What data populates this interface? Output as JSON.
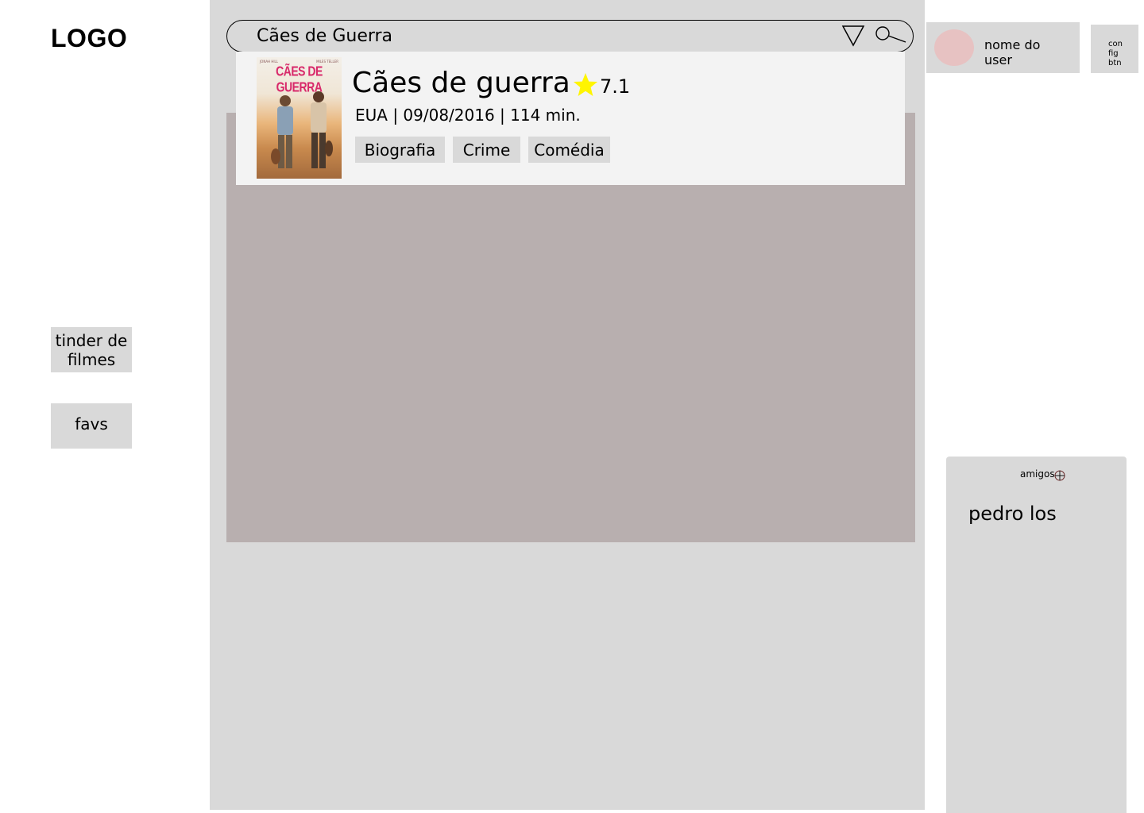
{
  "sidebar": {
    "logo": "LOGO",
    "items": [
      {
        "label": "tinder de filmes"
      },
      {
        "label": "favs"
      }
    ]
  },
  "search": {
    "value": "Cães de Guerra",
    "placeholder": "",
    "icons": [
      "filter-triangle-icon",
      "search-icon"
    ]
  },
  "result": {
    "poster_title": "CÃES DE GUERRA",
    "poster_credit_left": "JONAH HILL",
    "poster_credit_right": "MILES TELLER",
    "title": "Cães de guerra",
    "rating": "7.1",
    "rating_icon": "star-icon",
    "rating_color": "#fff500",
    "meta": "EUA | 09/08/2016 | 114 min.",
    "genres": [
      "Biografia",
      "Crime",
      "Comédia"
    ]
  },
  "user": {
    "name": "nome do user",
    "avatar_color": "#e7c2c2",
    "config_label": "con fig btn"
  },
  "friends": {
    "title": "amigos",
    "add_icon": "add-circle-icon",
    "items": [
      "pedro los"
    ]
  },
  "colors": {
    "panel": "#d9d9d9",
    "content": "#b8afaf",
    "dropdown": "#f3f3f3"
  }
}
